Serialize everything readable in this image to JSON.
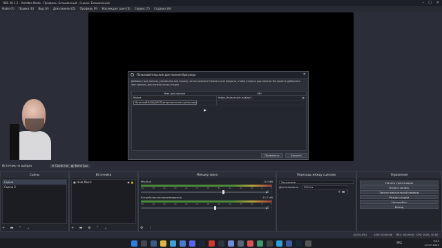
{
  "window": {
    "title": "OBS 28.1.2 - Portable Mode - Профиль: Безымянный - Сцены: Безымянный"
  },
  "menu": [
    "Файл (F)",
    "Правка (E)",
    "Вид (V)",
    "Док-панели (D)",
    "Профиль (P)",
    "Коллекция сцен (S)",
    "Сервис (T)",
    "Справка (H)"
  ],
  "dialog": {
    "title": "Пользовательские док-панели браузера",
    "description": "Добавьте док-панели, указав имя или ссылку, затем нажмите Принять или Закрыть, чтобы открыть док-панели. Вы можете добавлять или удалять док-панели когда угодно.",
    "col_name": "Имя док-панели",
    "col_url": "URL",
    "rows": [
      {
        "name": "Музка",
        "url": "https://hula-music.ru/stvo?..."
      }
    ],
    "new_row_value": "МузилкаВКАШ[ДРОП\\вторникпокласщитвулиш",
    "apply_label": "Применить",
    "close_label": "Закрыть"
  },
  "source_bar": {
    "label": "Источник не выбран",
    "properties_label": "Свойства",
    "filters_label": "Фильтры"
  },
  "scenes": {
    "title": "Сцены",
    "items": [
      "Сцена",
      "Сцена 2"
    ]
  },
  "sources": {
    "title": "Источники",
    "items": [
      {
        "name": "Hula Music"
      }
    ]
  },
  "mixer": {
    "title": "Микшер звука",
    "tracks": [
      {
        "name": "Mic/Aux",
        "db": "-0.0 dB",
        "volume": 0.65
      },
      {
        "name": "Устройство воспроизведения",
        "db": "-11.7 dB",
        "volume": 0.58
      }
    ],
    "scale": [
      "-60",
      "-55",
      "-50",
      "-45",
      "-40",
      "-35",
      "-30",
      "-25",
      "-20",
      "-15",
      "-10",
      "-5",
      "0"
    ]
  },
  "transitions": {
    "title": "Переходы между сценами",
    "type": "Затухание",
    "duration_label": "Длительность",
    "duration_value": "300 ms"
  },
  "controls": {
    "title": "Управление",
    "buttons": [
      "Начать трансляцию",
      "Начать запись",
      "Запуск виртуальной камеры",
      "Режим студии",
      "Настройки",
      "Выход"
    ]
  },
  "status": {
    "rec": "REC: 00:00:00",
    "live": "LIVE: 00:00:00",
    "cpu": "CPU: 0.0%, 30.00 fps",
    "dropped": "0/0 (0.0%)"
  },
  "taskbar": {
    "lang": "РУС",
    "time": "0:44",
    "date": "17.07.2023"
  },
  "colors": {
    "accent": "#3c4151",
    "window_bg": "#2b2e38",
    "canvas": "#000000"
  }
}
